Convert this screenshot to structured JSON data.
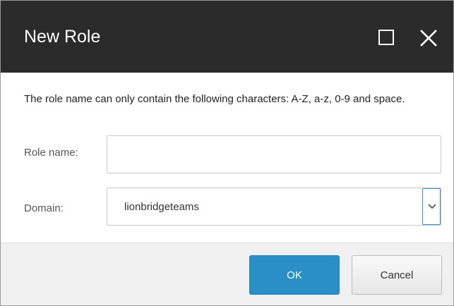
{
  "dialog": {
    "title": "New Role",
    "message": "The role name can only contain the following characters: A-Z, a-z, 0-9 and space.",
    "maximize_icon": "maximize-icon",
    "close_icon": "close-icon"
  },
  "form": {
    "role_name": {
      "label": "Role name:",
      "value": "",
      "placeholder": ""
    },
    "domain": {
      "label": "Domain:",
      "selected": "lionbridgeteams",
      "arrow_icon": "chevron-down-icon"
    }
  },
  "buttons": {
    "ok_label": "OK",
    "cancel_label": "Cancel"
  },
  "colors": {
    "titlebar": "#2b2b2b",
    "ok_button": "#2a8fc6",
    "footer": "#f0f0f0",
    "select_accent": "#3e90c9"
  }
}
